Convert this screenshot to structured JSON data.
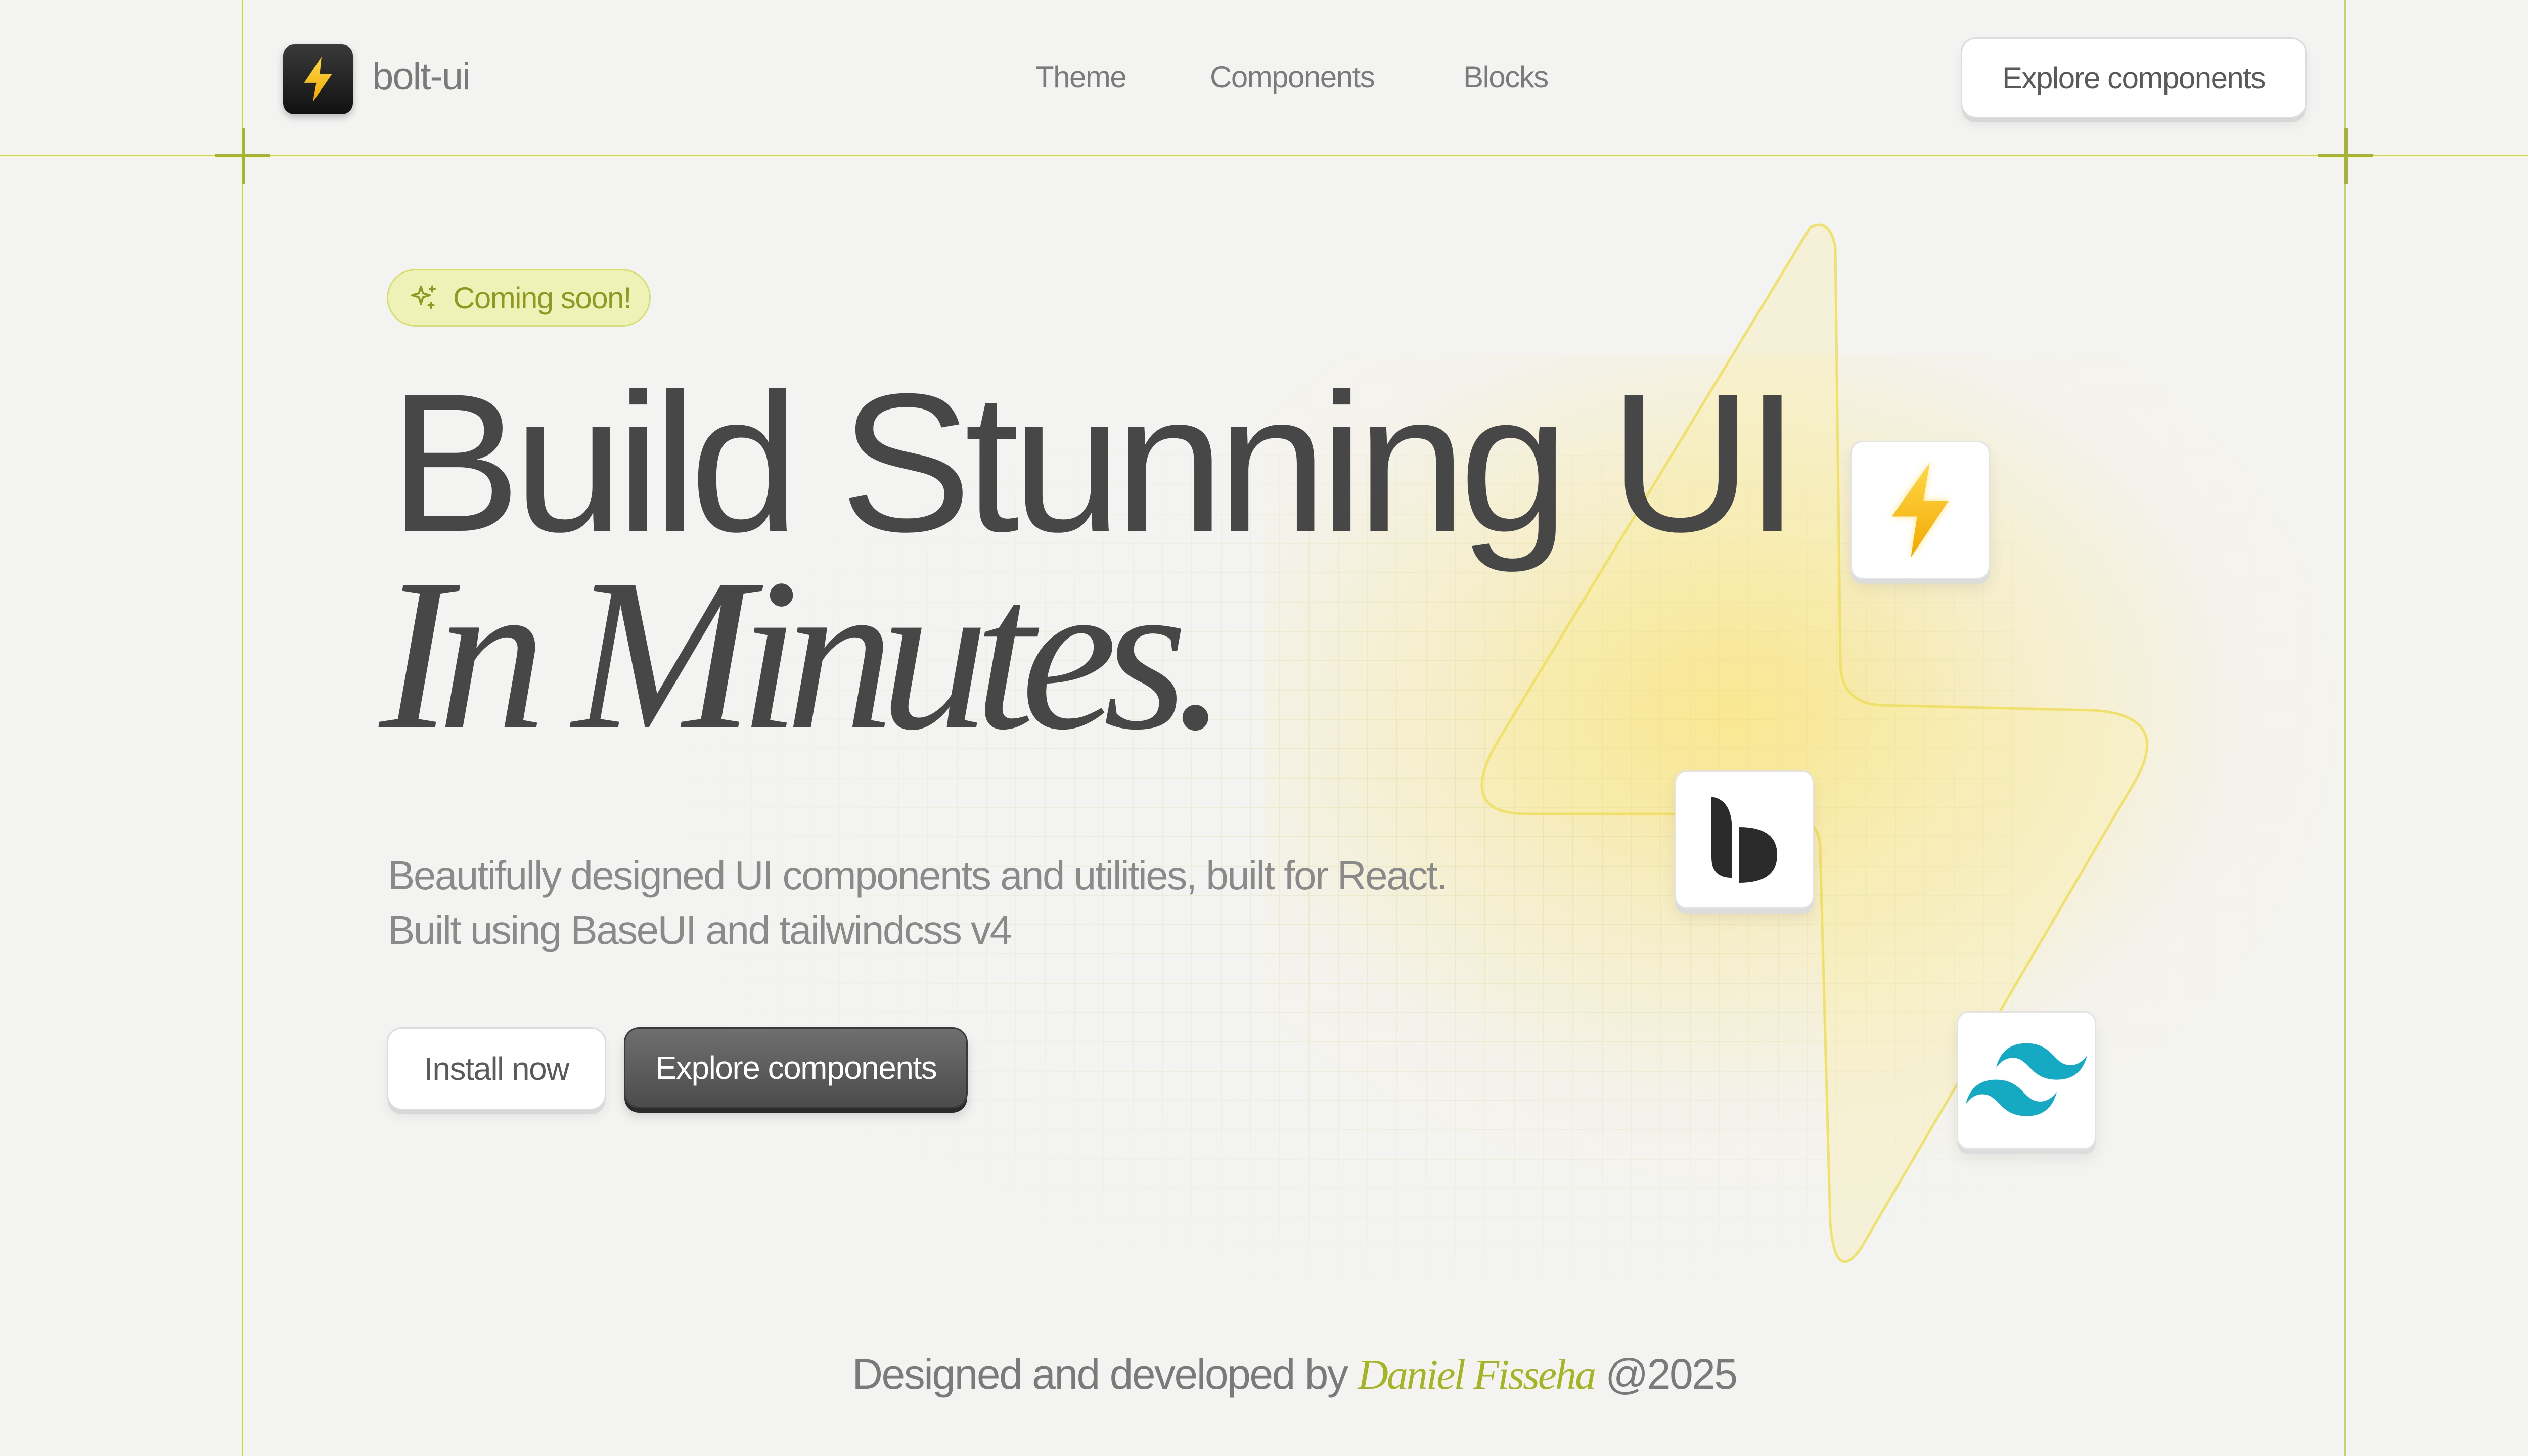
{
  "nav": {
    "logo_icon": "bolt-icon",
    "logo_text": "bolt-ui",
    "links": [
      "Theme",
      "Components",
      "Blocks"
    ],
    "cta_label": "Explore components"
  },
  "hero": {
    "badge_icon": "sparkles-icon",
    "badge_label": "Coming soon!",
    "headline": "Build Stunning UI",
    "headline_italic": "In Minutes.",
    "description_line1": "Beautifully designed UI components and utilities, built for React.",
    "description_line2": "Built using BaseUI and tailwindcss v4",
    "install_label": "Install now",
    "explore_label": "Explore components"
  },
  "tech_icons": [
    "bolt-icon",
    "baseui-logo-icon",
    "tailwindcss-logo-icon"
  ],
  "footer": {
    "prefix": "Designed and developed by",
    "author": "Daniel Fisseha",
    "suffix": "@2025"
  },
  "colors": {
    "accent": "#a5b424",
    "accent_light": "#eff2b6",
    "bolt_yellow": "#f7c21a",
    "text_dark": "#474747",
    "text_muted": "#8a8a8a",
    "background": "#f3f3f2",
    "tailwind_cyan": "#16a9c4"
  }
}
